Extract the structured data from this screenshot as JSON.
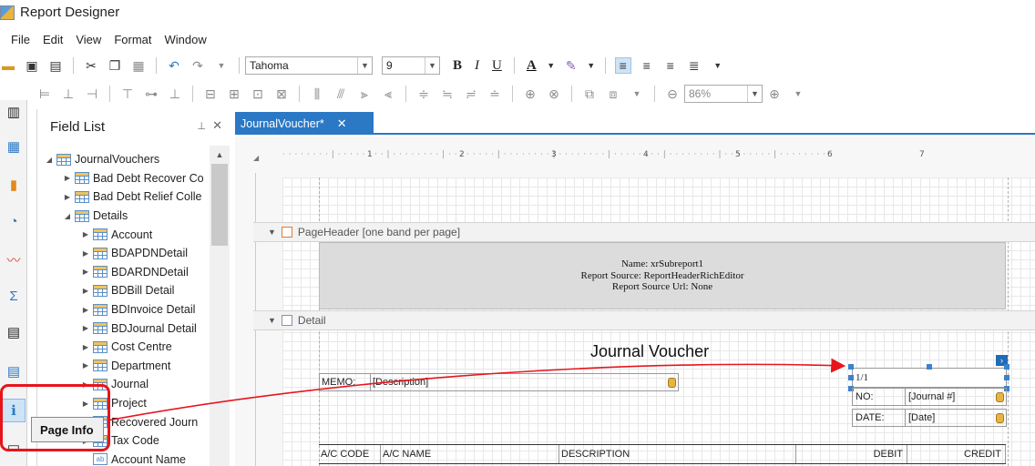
{
  "window": {
    "title": "Report Designer"
  },
  "menu": [
    "File",
    "Edit",
    "View",
    "Format",
    "Window"
  ],
  "toolbar": {
    "font_name": "Tahoma",
    "font_size": "9",
    "zoom": "86%",
    "bold": "B",
    "italic": "I",
    "underline": "U",
    "font_color": "A"
  },
  "field_list": {
    "title": "Field List",
    "items": [
      {
        "label": "JournalVouchers",
        "level": 0,
        "expanded": true
      },
      {
        "label": "Bad Debt Recover Co",
        "level": 1,
        "expanded": false
      },
      {
        "label": "Bad Debt Relief Colle",
        "level": 1,
        "expanded": false
      },
      {
        "label": "Details",
        "level": 1,
        "expanded": true
      },
      {
        "label": "Account",
        "level": 2,
        "expanded": false
      },
      {
        "label": "BDAPDNDetail",
        "level": 2,
        "expanded": false
      },
      {
        "label": "BDARDNDetail",
        "level": 2,
        "expanded": false
      },
      {
        "label": "BDBill Detail",
        "level": 2,
        "expanded": false
      },
      {
        "label": "BDInvoice Detail",
        "level": 2,
        "expanded": false
      },
      {
        "label": "BDJournal Detail",
        "level": 2,
        "expanded": false
      },
      {
        "label": "Cost Centre",
        "level": 2,
        "expanded": false
      },
      {
        "label": "Department",
        "level": 2,
        "expanded": false
      },
      {
        "label": "Journal",
        "level": 2,
        "expanded": false
      },
      {
        "label": "Project",
        "level": 2,
        "expanded": false
      },
      {
        "label": "Recovered Journ",
        "level": 2,
        "expanded": false
      },
      {
        "label": "Tax Code",
        "level": 2,
        "expanded": false
      },
      {
        "label": "Account Name",
        "level": 2,
        "type": "field"
      }
    ]
  },
  "document_tab": {
    "label": "JournalVoucher*",
    "close": "✕"
  },
  "ruler": {
    "marks": [
      "1",
      "2",
      "3",
      "4",
      "5",
      "6",
      "7"
    ]
  },
  "bands": {
    "page_header": "PageHeader [one band per page]",
    "detail": "Detail"
  },
  "subreport": {
    "line1": "Name: xrSubreport1",
    "line2": "Report Source: ReportHeaderRichEditor",
    "line3": "Report Source Url: None"
  },
  "report": {
    "title": "Journal Voucher",
    "memo_label": "MEMO:",
    "memo_value": "[Description]",
    "page_info_value": "1/1",
    "no_label": "NO:",
    "no_value": "[Journal #]",
    "date_label": "DATE:",
    "date_value": "[Date]",
    "columns": [
      "A/C CODE",
      "A/C NAME",
      "DESCRIPTION",
      "DEBIT",
      "CREDIT"
    ]
  },
  "tooltip": {
    "text": "Page Info"
  },
  "colors": {
    "accent": "#2b78c5",
    "highlight": "#e8141c"
  }
}
